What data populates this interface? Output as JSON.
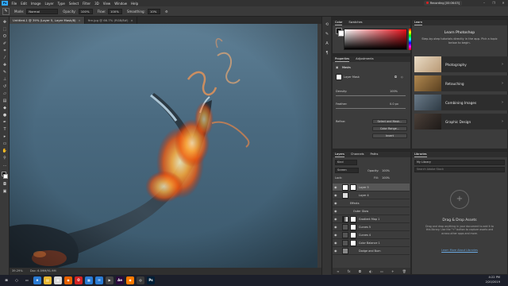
{
  "menubar": {
    "app_logo": "Ps",
    "items": [
      "File",
      "Edit",
      "Image",
      "Layer",
      "Type",
      "Select",
      "Filter",
      "3D",
      "View",
      "Window",
      "Help"
    ],
    "recording_label": "Recording [00:06:03]",
    "window_buttons": [
      "–",
      "❐",
      "✕"
    ]
  },
  "options_bar": {
    "tool_icon": "brush-tool-icon",
    "mode_label": "Mode:",
    "mode_value": "Normal",
    "opacity_label": "Opacity:",
    "opacity_value": "100%",
    "flow_label": "Flow:",
    "flow_value": "100%",
    "smoothing_label": "Smoothing:",
    "smoothing_value": "10%"
  },
  "tabs": [
    {
      "label": "Untitled-1 @ 39% (Layer 5, Layer Mask/8)",
      "active": true
    },
    {
      "label": "fire.jpg @ 66.7% (RGB/8#)",
      "active": false
    }
  ],
  "status_bar": {
    "zoom": "39.29%",
    "doc": "Doc: 6.59M/91.9M"
  },
  "color_panel": {
    "tabs": [
      "Color",
      "Swatches"
    ],
    "active_tab": "Color",
    "accent_hue": "#e8101a"
  },
  "properties_panel": {
    "tabs": [
      "Properties",
      "Adjustments"
    ],
    "title": "Masks",
    "layer_mask_label": "Layer Mask",
    "density_label": "Density:",
    "density_value": "100%",
    "feather_label": "Feather:",
    "feather_value": "0.0 px",
    "refine_label": "Refine:",
    "buttons": [
      "Select and Mask...",
      "Color Range...",
      "Invert"
    ]
  },
  "learn_panel": {
    "tab": "Learn",
    "heading": "Learn Photoshop",
    "subheading": "Step-by-step tutorials directly in the app. Pick a topic below to begin.",
    "items": [
      {
        "label": "Photography",
        "thumb_color": "#c9b8a0"
      },
      {
        "label": "Retouching",
        "thumb_color": "#8a6a40"
      },
      {
        "label": "Combining Images",
        "thumb_color": "#4d5c68"
      },
      {
        "label": "Graphic Design",
        "thumb_color": "#3a3330"
      }
    ]
  },
  "layers_panel": {
    "tabs": [
      "Layers",
      "Channels",
      "Paths"
    ],
    "active_tab": "Layers",
    "kind_label": "Kind",
    "blend_mode": "Screen",
    "opacity_label": "Opacity:",
    "opacity_value": "100%",
    "lock_label": "Lock:",
    "fill_label": "Fill:",
    "fill_value": "100%",
    "layers": [
      {
        "name": "Layer 5",
        "selected": true
      },
      {
        "name": "Layer 4",
        "selected": false
      },
      {
        "name": "Effects",
        "selected": false
      },
      {
        "name": "Outer Glow",
        "selected": false
      },
      {
        "name": "Gradient Map 1",
        "selected": false
      },
      {
        "name": "Curves 5",
        "selected": false
      },
      {
        "name": "Curves 4",
        "selected": false
      },
      {
        "name": "Color Balance 1",
        "selected": false
      },
      {
        "name": "Dodge and Burn",
        "selected": false
      }
    ]
  },
  "libraries_panel": {
    "tab": "Libraries",
    "library_select": "My Library",
    "search_placeholder": "Search Adobe Stock",
    "drop_title": "Drag & Drop Assets",
    "drop_text": "Drag and drop anything in your document to add it to this library. Use the \"+\" button to capture assets and across other apps and more.",
    "link_text": "Learn More About Libraries"
  },
  "taskbar": {
    "icons": [
      {
        "name": "start-icon",
        "color": "#1c1f2a",
        "glyph": "⊞"
      },
      {
        "name": "search-icon",
        "color": "#1c1f2a",
        "glyph": "○"
      },
      {
        "name": "taskview-icon",
        "color": "#1c1f2a",
        "glyph": "▭"
      },
      {
        "name": "edge-icon",
        "color": "#2a7bd4",
        "glyph": "e"
      },
      {
        "name": "explorer-icon",
        "color": "#e8b732",
        "glyph": "▤"
      },
      {
        "name": "chrome-icon",
        "color": "#d9d9d9",
        "glyph": "◉"
      },
      {
        "name": "firefox-icon",
        "color": "#e66000",
        "glyph": "◉"
      },
      {
        "name": "opera-icon",
        "color": "#d42323",
        "glyph": "O"
      },
      {
        "name": "store-icon",
        "color": "#2a7bd4",
        "glyph": "▦"
      },
      {
        "name": "mail-icon",
        "color": "#2a7bd4",
        "glyph": "✉"
      },
      {
        "name": "media-icon",
        "color": "#444",
        "glyph": "▶"
      },
      {
        "name": "aftereffects-icon",
        "color": "#2b0a3d",
        "glyph": "Ae"
      },
      {
        "name": "app-icon",
        "color": "#ff7a00",
        "glyph": "◆"
      },
      {
        "name": "camera-icon",
        "color": "#3a3a3a",
        "glyph": "◎"
      },
      {
        "name": "photoshop-icon",
        "color": "#001e36",
        "glyph": "Ps"
      }
    ],
    "time": "4:22 PM",
    "date": "2/20/2019"
  }
}
